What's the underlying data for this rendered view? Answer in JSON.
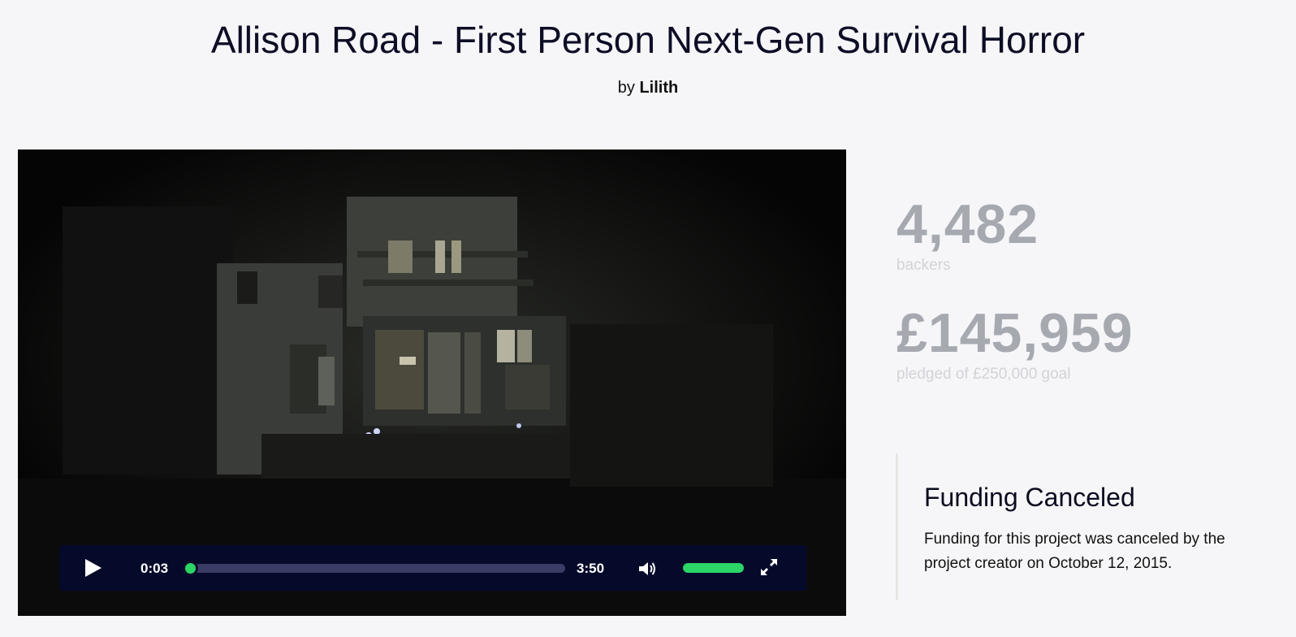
{
  "project": {
    "title": "Allison Road - First Person Next-Gen Survival Horror",
    "by_prefix": "by",
    "creator": "Lilith"
  },
  "video": {
    "current_time": "0:03",
    "duration": "3:50",
    "progress_fraction": 0.013,
    "volume_fraction": 1.0,
    "icons": [
      "play-icon",
      "volume-icon",
      "fullscreen-icon"
    ],
    "accent_color": "#2bd566",
    "control_bar_color": "#050a2b"
  },
  "stats": {
    "backers_count": "4,482",
    "backers_label": "backers",
    "pledged_amount": "£145,959",
    "pledged_label": "pledged of £250,000 goal"
  },
  "notice": {
    "heading": "Funding Canceled",
    "body": "Funding for this project was canceled by the project creator on October 12, 2015."
  }
}
